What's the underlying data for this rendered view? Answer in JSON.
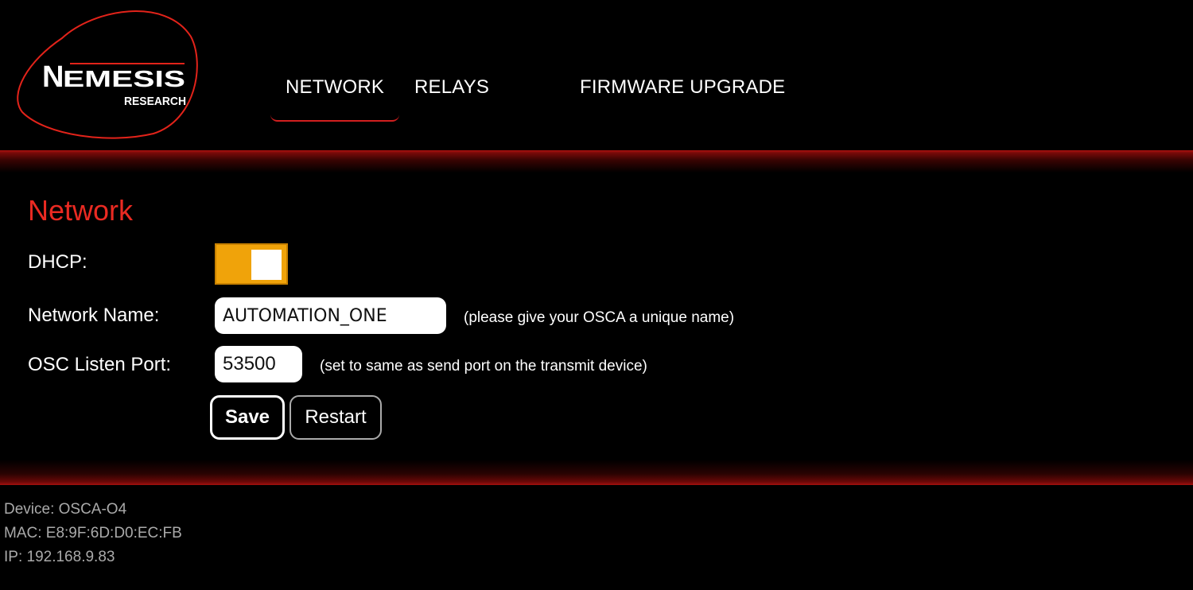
{
  "brand": {
    "logo_main": "NEMESIS",
    "logo_sub": "RESEARCH",
    "accent_color": "#ea2a22",
    "toggle_color": "#f0a30a"
  },
  "nav": {
    "items": [
      {
        "label": "NETWORK",
        "active": true
      },
      {
        "label": "RELAYS",
        "active": false
      },
      {
        "label": "FIRMWARE UPGRADE",
        "active": false
      }
    ]
  },
  "network": {
    "title": "Network",
    "dhcp_label": "DHCP:",
    "dhcp_enabled": true,
    "name_label": "Network Name:",
    "name_value": "AUTOMATION_ONE",
    "name_hint": "(please give your OSCA a unique name)",
    "port_label": "OSC Listen Port:",
    "port_value": "53500",
    "port_hint": "(set to same as send port on the transmit device)",
    "save_label": "Save",
    "restart_label": "Restart"
  },
  "footer": {
    "device": "Device: OSCA-O4",
    "mac": "MAC: E8:9F:6D:D0:EC:FB",
    "ip": "IP: 192.168.9.83"
  }
}
